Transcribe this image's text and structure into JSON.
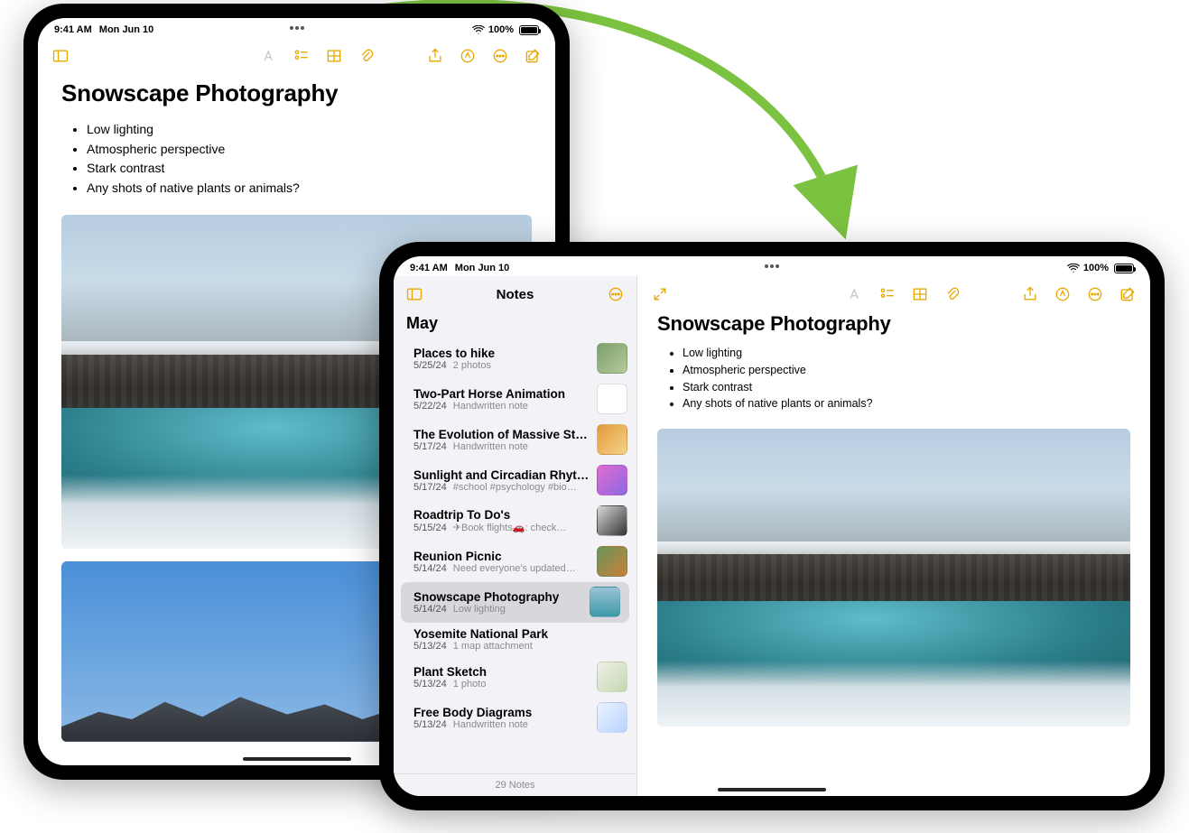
{
  "status": {
    "time": "9:41 AM",
    "date": "Mon Jun 10",
    "battery_text": "100%"
  },
  "note": {
    "title": "Snowscape Photography",
    "bullets": [
      "Low lighting",
      "Atmospheric perspective",
      "Stark contrast",
      "Any shots of native plants or animals?"
    ]
  },
  "sidebar": {
    "title": "Notes",
    "section": "May",
    "footer": "29 Notes",
    "items": [
      {
        "title": "Places to hike",
        "date": "5/25/24",
        "preview": "2 photos",
        "thumb": "th-a"
      },
      {
        "title": "Two-Part Horse Animation",
        "date": "5/22/24",
        "preview": "Handwritten note",
        "thumb": "th-b"
      },
      {
        "title": "The Evolution of Massive Star…",
        "date": "5/17/24",
        "preview": "Handwritten note",
        "thumb": "th-c"
      },
      {
        "title": "Sunlight and Circadian Rhyth…",
        "date": "5/17/24",
        "preview": "#school #psychology #bio…",
        "thumb": "th-d"
      },
      {
        "title": "Roadtrip To Do's",
        "date": "5/15/24",
        "preview": "✈︎Book flights🚗: check…",
        "thumb": "th-e"
      },
      {
        "title": "Reunion Picnic",
        "date": "5/14/24",
        "preview": "Need everyone's updated…",
        "thumb": "th-f"
      },
      {
        "title": "Snowscape Photography",
        "date": "5/14/24",
        "preview": "Low lighting",
        "thumb": "th-g",
        "selected": true
      },
      {
        "title": "Yosemite National Park",
        "date": "5/13/24",
        "preview": "1 map attachment",
        "thumb": ""
      },
      {
        "title": "Plant Sketch",
        "date": "5/13/24",
        "preview": "1 photo",
        "thumb": "th-h"
      },
      {
        "title": "Free Body Diagrams",
        "date": "5/13/24",
        "preview": "Handwritten note",
        "thumb": "th-i"
      }
    ]
  }
}
